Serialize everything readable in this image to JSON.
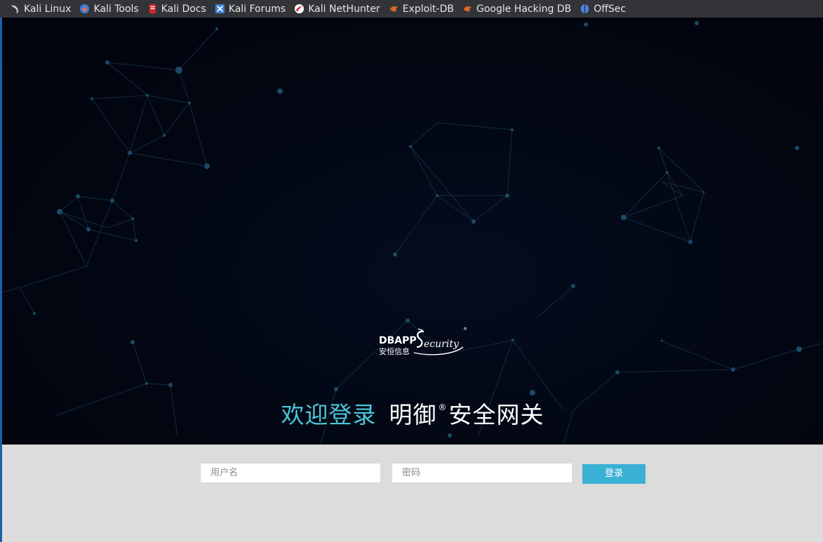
{
  "bookmarks": [
    {
      "label": "Kali Linux",
      "icon": "kali-dragon-icon",
      "color": "#cfcfcf"
    },
    {
      "label": "Kali Tools",
      "icon": "kali-tools-icon",
      "color": "#3d7fd6"
    },
    {
      "label": "Kali Docs",
      "icon": "kali-docs-icon",
      "color": "#d02a2a"
    },
    {
      "label": "Kali Forums",
      "icon": "kali-forums-icon",
      "color": "#3d7fd6"
    },
    {
      "label": "Kali NetHunter",
      "icon": "nethunter-icon",
      "color": "#d02a2a"
    },
    {
      "label": "Exploit-DB",
      "icon": "exploit-db-icon",
      "color": "#e0662a"
    },
    {
      "label": "Google Hacking DB",
      "icon": "ghdb-icon",
      "color": "#e0662a"
    },
    {
      "label": "OffSec",
      "icon": "offsec-icon",
      "color": "#4a86e0"
    }
  ],
  "logo": {
    "brand_en": "DBAPP",
    "brand_script": "ecurity",
    "brand_cn": "安恒信息",
    "registered": "®"
  },
  "welcome": {
    "greeting": "欢迎登录",
    "product_part1": "明御",
    "registered": "®",
    "product_part2": "安全网关"
  },
  "login": {
    "username_placeholder": "用户名",
    "password_placeholder": "密码",
    "submit_label": "登录"
  },
  "colors": {
    "accent": "#3ab0d4",
    "greeting": "#4dc6d8",
    "hero_bg": "#020611",
    "form_bg": "#dcdcdc"
  }
}
